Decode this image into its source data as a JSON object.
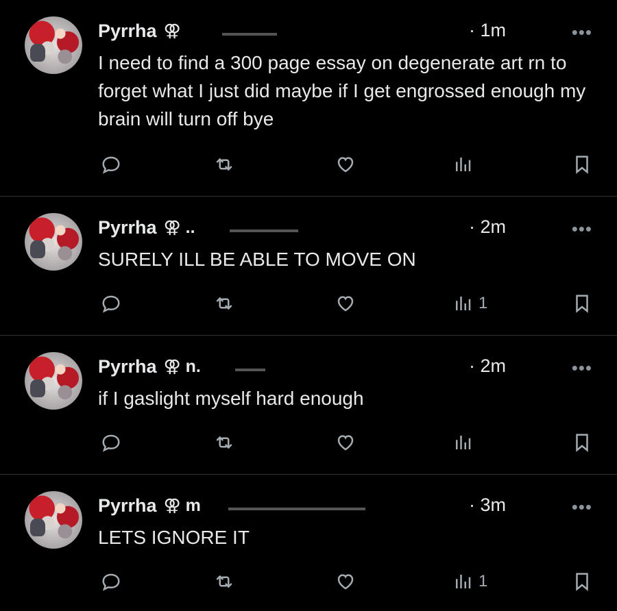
{
  "tweets": [
    {
      "author": "Pyrrha",
      "symbol": "⚢",
      "time": "· 1m",
      "text": "I need to find a 300 page essay on degenerate art rn to forget what I just did maybe if I get engrossed enough my brain will turn off bye",
      "views": ""
    },
    {
      "author": "Pyrrha",
      "symbol": "⚢ ..",
      "time": "· 2m",
      "text": "SURELY ILL BE ABLE TO MOVE ON",
      "views": "1"
    },
    {
      "author": "Pyrrha",
      "symbol": "⚢ n.",
      "time": "· 2m",
      "text": "if I gaslight myself hard enough",
      "views": ""
    },
    {
      "author": "Pyrrha",
      "symbol": "⚢ m",
      "time": "· 3m",
      "text": "LETS IGNORE IT",
      "views": "1"
    }
  ],
  "more_label": "•••",
  "icons": [
    "reply-icon",
    "retweet-icon",
    "like-icon",
    "views-icon",
    "bookmark-icon",
    "more-icon"
  ]
}
